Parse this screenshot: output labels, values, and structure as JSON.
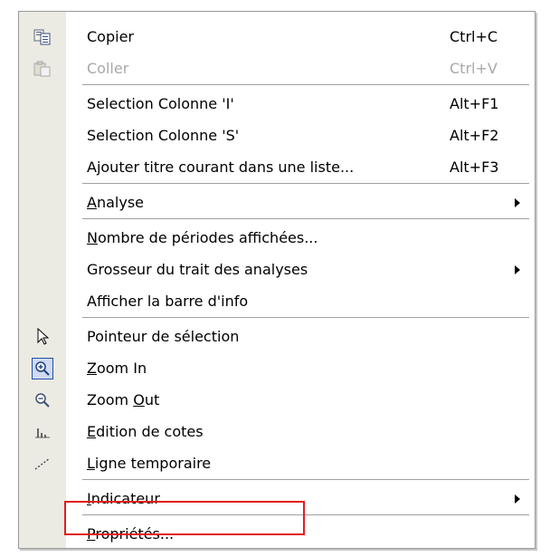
{
  "menu": {
    "items": [
      {
        "label_pre": "",
        "label_u": "",
        "label_post": "Copier",
        "shortcut": "Ctrl+C",
        "icon": "copy-icon"
      },
      {
        "label_pre": "",
        "label_u": "",
        "label_post": "Coller",
        "shortcut": "Ctrl+V",
        "icon": "paste-icon",
        "disabled": true
      },
      {
        "label_pre": "",
        "label_u": "",
        "label_post": "Selection Colonne 'I'",
        "shortcut": "Alt+F1"
      },
      {
        "label_pre": "",
        "label_u": "",
        "label_post": "Selection Colonne 'S'",
        "shortcut": "Alt+F2"
      },
      {
        "label_pre": "",
        "label_u": "",
        "label_post": "Ajouter titre courant dans une liste...",
        "shortcut": "Alt+F3"
      },
      {
        "label_pre": "",
        "label_u": "A",
        "label_post": "nalyse",
        "submenu": true
      },
      {
        "label_pre": "",
        "label_u": "N",
        "label_post": "ombre de périodes affichées..."
      },
      {
        "label_pre": "",
        "label_u": "",
        "label_post": "Grosseur du trait des analyses",
        "submenu": true
      },
      {
        "label_pre": "",
        "label_u": "",
        "label_post": "Afficher la barre d'info"
      },
      {
        "label_pre": "",
        "label_u": "",
        "label_post": "Pointeur de sélection",
        "icon": "pointer-icon"
      },
      {
        "label_pre": "",
        "label_u": "Z",
        "label_post": "oom In",
        "icon": "zoom-in-icon"
      },
      {
        "label_pre": "Zoom ",
        "label_u": "O",
        "label_post": "ut",
        "icon": "zoom-out-icon"
      },
      {
        "label_pre": "",
        "label_u": "E",
        "label_post": "dition de cotes",
        "icon": "edit-ratings-icon"
      },
      {
        "label_pre": "",
        "label_u": "L",
        "label_post": "igne temporaire",
        "icon": "temp-line-icon"
      },
      {
        "label_pre": "",
        "label_u": "I",
        "label_post": "ndicateur",
        "submenu": true
      },
      {
        "label_pre": "",
        "label_u": "P",
        "label_post": "ropriétés..."
      }
    ]
  },
  "colors": {
    "gutter": "#ecebe3",
    "highlight": "#e21d1d",
    "disabled_text": "#a8a8a8"
  }
}
